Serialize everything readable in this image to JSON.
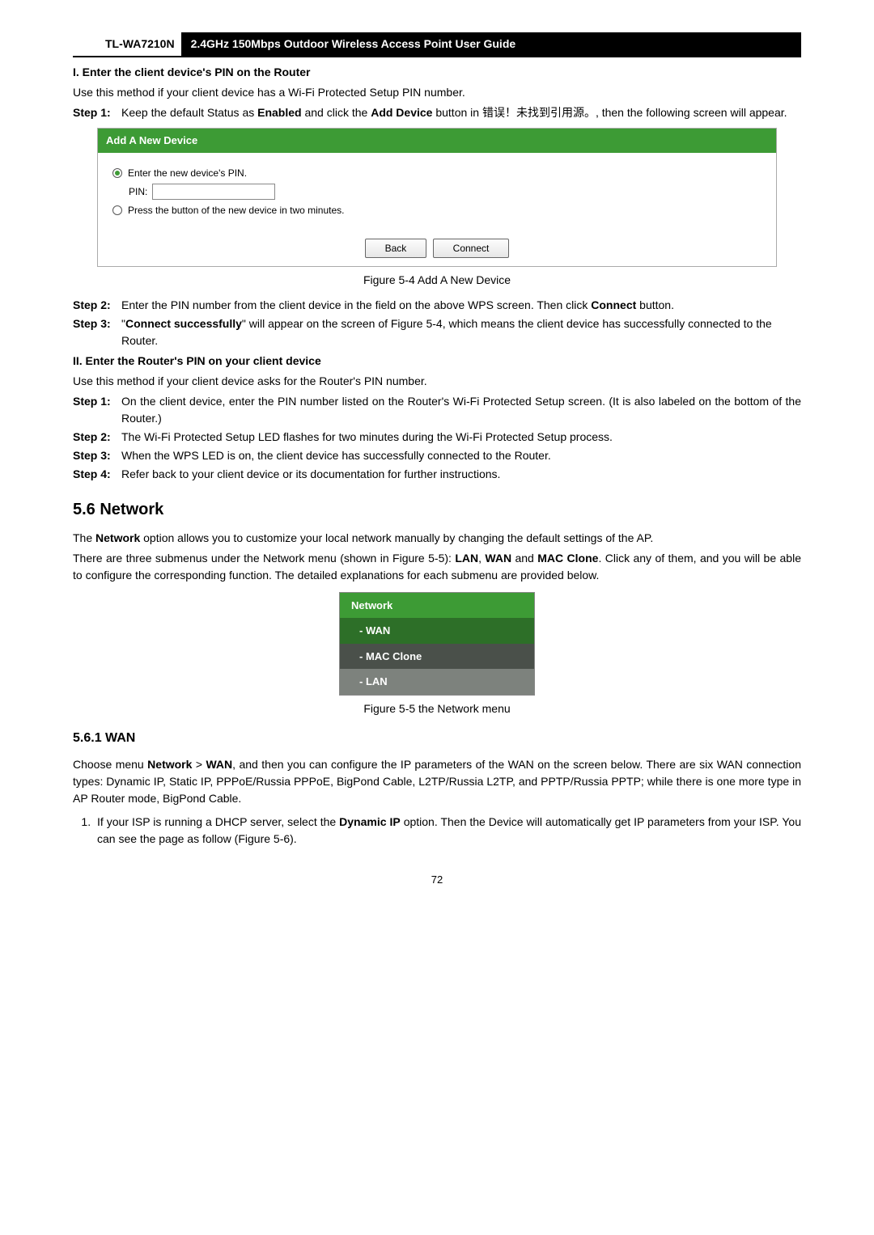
{
  "header": {
    "model": "TL-WA7210N",
    "title": "2.4GHz 150Mbps Outdoor Wireless Access Point User Guide"
  },
  "sec1": {
    "heading": "I.   Enter the client device's PIN on the Router",
    "intro": "Use this method if your client device has a Wi-Fi Protected Setup PIN number.",
    "step1_label": "Step 1:",
    "step1_a": "Keep the default   Status as ",
    "step1_b": "Enabled",
    "step1_c": " and click the ",
    "step1_d": "Add Device",
    "step1_e": " button in  错误！未找到引用源。, then the following screen will appear."
  },
  "wps": {
    "title": "Add A New Device",
    "radio1": "Enter the new device's PIN.",
    "pin_label": "PIN:",
    "radio2": "Press the button of the new device in two minutes.",
    "btn_back": "Back",
    "btn_connect": "Connect"
  },
  "fig54": "Figure 5-4   Add A New Device",
  "sec1b": {
    "step2_label": "Step 2:",
    "step2_a": "Enter the PIN number from the client device in the field on the above WPS screen. Then click ",
    "step2_b": "Connect",
    "step2_c": " button.",
    "step3_label": "Step 3:",
    "step3_a": "\"",
    "step3_b": "Connect successfully",
    "step3_c": "\" will appear on the screen of Figure 5-4, which means the client device has successfully connected to the Router."
  },
  "sec2": {
    "heading": "II.   Enter the Router's PIN on your client device",
    "intro": "Use this method if your client device asks for the Router's PIN number.",
    "s1l": "Step 1:",
    "s1": "On the client device, enter the PIN number listed on the Router's Wi-Fi Protected Setup screen. (It is also labeled on the bottom of the Router.)",
    "s2l": "Step 2:",
    "s2": "The Wi-Fi Protected Setup LED flashes for two minutes during the Wi-Fi Protected Setup process.",
    "s3l": "Step 3:",
    "s3": "When the WPS LED is on, the client device has successfully connected to the Router.",
    "s4l": "Step 4:",
    "s4": "Refer back to your client device or its documentation for further instructions."
  },
  "h56": "5.6    Network",
  "net_p1a": "The ",
  "net_p1b": "Network",
  "net_p1c": " option allows you to customize your local network manually by changing the default settings of the AP.",
  "net_p2a": "There are three submenus under the Network menu (shown in Figure 5-5): ",
  "net_p2b": "LAN",
  "net_p2c": ", ",
  "net_p2d": "WAN",
  "net_p2e": " and ",
  "net_p2f": "MAC Clone",
  "net_p2g": ". Click any of them, and you will be able to configure the corresponding function. The detailed explanations for each submenu are provided below.",
  "menu": {
    "head": "Network",
    "wan": "- WAN",
    "mac": "- MAC Clone",
    "lan": "- LAN"
  },
  "fig55": "Figure 5-5 the Network menu",
  "h561": "5.6.1      WAN",
  "wan_p1a": "Choose menu ",
  "wan_p1b": "Network",
  "wan_p1c": " > ",
  "wan_p1d": "WAN",
  "wan_p1e": ", and then you can configure the IP parameters of the WAN on the screen below. There are six WAN connection types: Dynamic IP, Static IP, PPPoE/Russia PPPoE, BigPond Cable, L2TP/Russia L2TP, and PPTP/Russia PPTP; while there is one more type in AP Router mode, BigPond Cable.",
  "li1a": "If your ISP is running a DHCP server, select the ",
  "li1b": "Dynamic IP",
  "li1c": " option. Then the Device will automatically get IP parameters from your ISP. You can see the page as follow (Figure 5-6).",
  "page": "72"
}
